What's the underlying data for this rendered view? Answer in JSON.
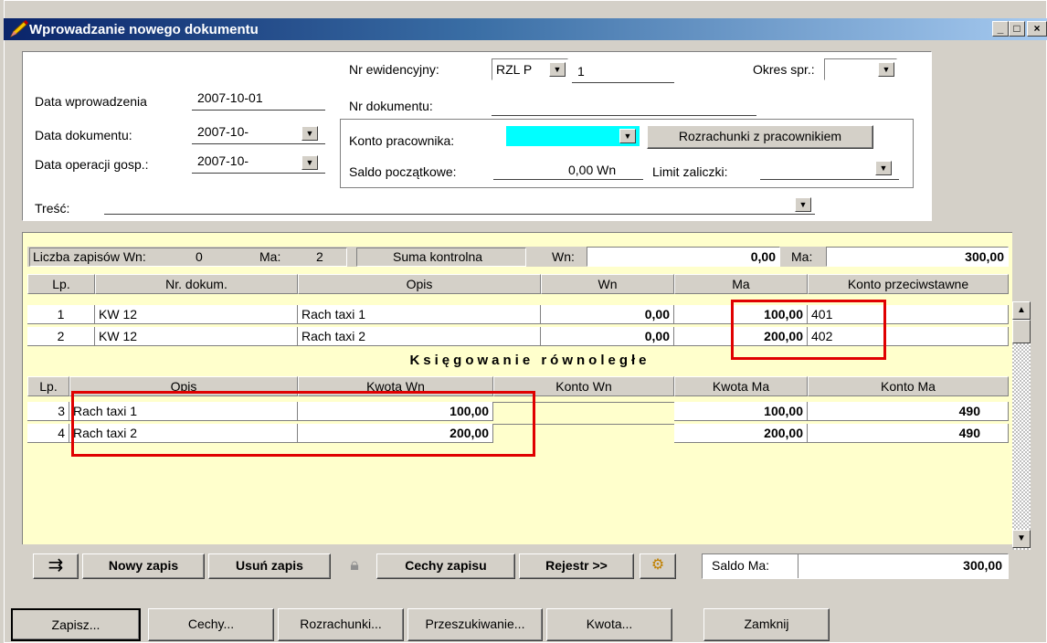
{
  "window": {
    "title": "Wprowadzanie nowego dokumentu",
    "min_icon": "minimize-icon",
    "max_icon": "maximize-icon",
    "close_icon": "close-icon"
  },
  "header": {
    "nr_ewidencyjny_label": "Nr ewidencyjny:",
    "nr_ewidencyjny_value": "RZL  P",
    "nr_ewidencyjny_num": "1",
    "okres_label": "Okres spr.:",
    "data_wprowadzenia_label": "Data wprowadzenia",
    "data_wprowadzenia_value": "2007-10-01",
    "nr_dokumentu_label": "Nr dokumentu:",
    "data_dokumentu_label": "Data dokumentu:",
    "data_dokumentu_value": "2007-10-",
    "data_operacji_label": "Data operacji gosp.:",
    "data_operacji_value": "2007-10-",
    "konto_pracownika_label": "Konto pracownika:",
    "rozrachunki_btn": "Rozrachunki z pracownikiem",
    "saldo_label": "Saldo początkowe:",
    "saldo_value": "0,00 Wn",
    "limit_label": "Limit zaliczki:",
    "tresc_label": "Treść:"
  },
  "summary": {
    "liczba_label": "Liczba zapisów Wn:",
    "liczba_wn": "0",
    "ma_label": "Ma:",
    "liczba_ma": "2",
    "suma_label": "Suma kontrolna",
    "wn_label": "Wn:",
    "wn_value": "0,00",
    "ma2_label": "Ma:",
    "ma_value": "300,00"
  },
  "grid1": {
    "headers": [
      "Lp.",
      "Nr. dokum.",
      "Opis",
      "Wn",
      "Ma",
      "Konto przeciwstawne"
    ],
    "rows": [
      {
        "lp": "1",
        "nr": "KW 12",
        "opis": "Rach taxi 1",
        "wn": "0,00",
        "ma": "100,00",
        "konto": "401"
      },
      {
        "lp": "2",
        "nr": "KW 12",
        "opis": "Rach taxi 2",
        "wn": "0,00",
        "ma": "200,00",
        "konto": "402"
      }
    ]
  },
  "parallel_label": "Księgowanie równoległe",
  "grid2": {
    "headers": [
      "Lp.",
      "Opis",
      "Kwota Wn",
      "Konto Wn",
      "Kwota Ma",
      "Konto Ma"
    ],
    "rows": [
      {
        "lp": "3",
        "opis": "Rach taxi 1",
        "kwota_wn": "100,00",
        "konto_wn": "",
        "kwota_ma": "100,00",
        "konto_ma": "490"
      },
      {
        "lp": "4",
        "opis": "Rach taxi 2",
        "kwota_wn": "200,00",
        "konto_wn": "",
        "kwota_ma": "200,00",
        "konto_ma": "490"
      }
    ]
  },
  "toolbar": {
    "nowy": "Nowy zapis",
    "usun": "Usuń zapis",
    "cechy_zapisu": "Cechy zapisu",
    "rejestr": "Rejestr >>",
    "saldo_ma_label": "Saldo Ma:",
    "saldo_ma_value": "300,00"
  },
  "bottom": {
    "zapisz": "Zapisz...",
    "cechy": "Cechy...",
    "rozrachunki": "Rozrachunki...",
    "przeszukiwanie": "Przeszukiwanie...",
    "kwota": "Kwota...",
    "zamknij": "Zamknij"
  },
  "colors": {
    "highlight_field": "#00ffff",
    "grid_bg": "#ffffcc",
    "annotation_red": "#e00000"
  }
}
